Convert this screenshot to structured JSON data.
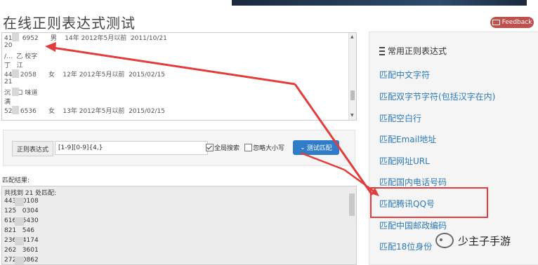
{
  "page": {
    "title": "在线正则表达式测试",
    "feedback_label": "Feedback"
  },
  "source_text": {
    "rows": [
      "41     6952      男    14年 2012年5月以前  2011/10/21",
      "20",
      "/...  乙 校字",
      "丁   江",
      "44    2058      女    12年 2012年5月以前  2015/02/15",
      "21",
      "沉   口 味道",
      "满",
      "52    6536      女    13年 2012年5月以前  2015/02/15"
    ]
  },
  "regex": {
    "label": "正则表达式",
    "value": "[1-9][0-9]{4,}",
    "global_label": "全局搜索",
    "global_checked": true,
    "ignore_case_label": "忽略大小写",
    "ignore_case_checked": false,
    "test_button": "测试匹配"
  },
  "result": {
    "label": "匹配结果:",
    "summary": "共找到 21 处匹配:",
    "rows": [
      "443   0108",
      "125   0304",
      "616   5430",
      "821   546",
      "236   4174",
      "262   3601",
      "272   0862"
    ]
  },
  "sidebar": {
    "title": "常用正则表达式",
    "links": [
      "匹配中文字符",
      "匹配双字节字符(包括汉字在内)",
      "匹配空白行",
      "匹配Email地址",
      "匹配网址URL",
      "匹配国内电话号码",
      "匹配腾讯QQ号",
      "匹配中国邮政编码",
      "匹配18位身份"
    ]
  },
  "watermark": {
    "text": "少主子手游"
  },
  "colors": {
    "accent": "#2f7cc8",
    "link": "#2a7ab8",
    "annotation": "#e23c3c",
    "feedback": "#c0504d"
  }
}
